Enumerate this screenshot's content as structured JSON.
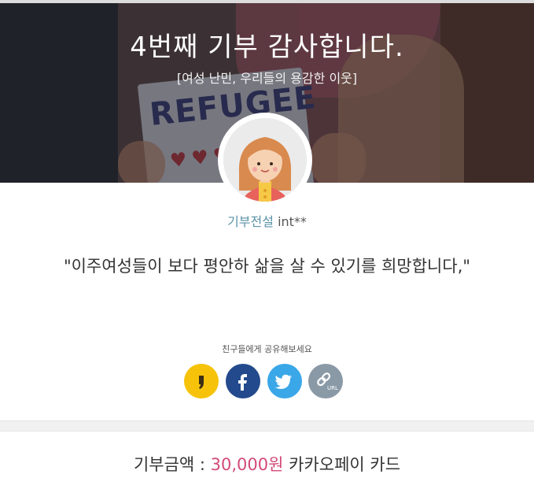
{
  "hero": {
    "title": "4번째 기부 감사합니다.",
    "subtitle": "[여성 난민, 우리들의 용감한 이웃]",
    "sign_text": "REFUGEE"
  },
  "donor": {
    "tier": "기부전설",
    "name": "int**"
  },
  "message": "\"이주여성들이 보다 평안하 삶을 살 수 있기를 희망합니다,\"",
  "share": {
    "label": "친구들에게 공유해보세요",
    "buttons": [
      {
        "name": "kakao",
        "icon": "kakao-talk-icon",
        "color": "#f6c30a"
      },
      {
        "name": "facebook",
        "icon": "facebook-icon",
        "color": "#234a8c"
      },
      {
        "name": "twitter",
        "icon": "twitter-icon",
        "color": "#3aa7e8"
      },
      {
        "name": "url",
        "icon": "link-url-icon",
        "color": "#8a99a6",
        "label": "URL"
      }
    ]
  },
  "donation": {
    "label": "기부금액 : ",
    "amount": "30,000원",
    "method": " 카카오페이 카드"
  }
}
